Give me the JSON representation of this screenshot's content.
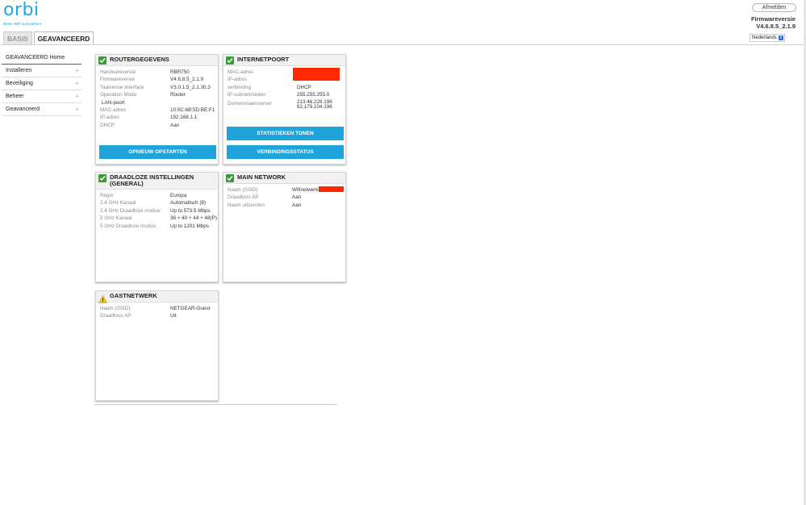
{
  "header": {
    "logo_text": "orbi",
    "tagline": "Better WiFi Everywhere",
    "logout_label": "Afmelden",
    "firmware_label": "Firmwareversie",
    "firmware_value": "V4.6.8.5_2.1.9",
    "language": "Nederlands"
  },
  "tabs": [
    {
      "label": "BASIS",
      "active": false
    },
    {
      "label": "GEAVANCEERD",
      "active": true
    }
  ],
  "sidebar": {
    "items": [
      {
        "label": "GEAVANCEERD Home",
        "expandable": false
      },
      {
        "label": "Installeren",
        "expandable": true
      },
      {
        "label": "Beveiliging",
        "expandable": true
      },
      {
        "label": "Beheer",
        "expandable": true
      },
      {
        "label": "Geavanceerd",
        "expandable": true
      }
    ],
    "plus": "+"
  },
  "router": {
    "title": "ROUTERGEGEVENS",
    "rows": [
      {
        "k": "Hardwareversie",
        "v": "RBR750"
      },
      {
        "k": "Firmwareversie",
        "v": "V4.6.8.5_2.1.9"
      },
      {
        "k": "Taalversie Interface",
        "v": "V3.0.1.5_2.1.30.3"
      },
      {
        "k": "Operation Mode",
        "v": "Router"
      },
      {
        "k": "LAN-poort",
        "v": ""
      },
      {
        "k": "MAC-adres",
        "v": "10:0C:6B:5D:BE:F1"
      },
      {
        "k": "IP-adres",
        "v": "192.168.1.1"
      },
      {
        "k": "DHCP",
        "v": "Aan"
      }
    ],
    "button": "OPNIEUW OPSTARTEN"
  },
  "internet": {
    "title": "INTERNETPOORT",
    "rows": [
      {
        "k": "MAC-adres",
        "v": ""
      },
      {
        "k": "IP-adres",
        "v": ""
      },
      {
        "k": "verbinding",
        "v": "DHCP"
      },
      {
        "k": "IP-subnetmasker",
        "v": "255.255.255.0"
      },
      {
        "k": "Domeinnaamserver",
        "v": "213.46.228.196"
      },
      {
        "k": "",
        "v": "62.179.104.196"
      }
    ],
    "button_stats": "STATISTIEKEN TONEN",
    "button_status": "VERBINDINGSSTATUS",
    "redact_color": "#ff2a00"
  },
  "wireless": {
    "title_line1": "DRAADLOZE INSTELLINGEN",
    "title_line2": "(GENERAL)",
    "rows": [
      {
        "k": "Regio",
        "v": "Europa"
      },
      {
        "k": "2.4 GHz Kanaal",
        "v": "Automatisch (8)"
      },
      {
        "k": "2.4 GHz Draadloze modus:",
        "v": "Up to 573.5 Mbps"
      },
      {
        "k": "5 GHz Kanaal",
        "v": "36 + 40 + 44 + 48(P)"
      },
      {
        "k": "5 GHz Draadloze modus:",
        "v": "Up to 1201 Mbps"
      }
    ]
  },
  "main_network": {
    "title": "MAIN NETWORK",
    "rows": [
      {
        "k": "Naam (SSID)",
        "v": "Wifinetwerk"
      },
      {
        "k": "Draadloos AP",
        "v": "Aan"
      },
      {
        "k": "Naam uitzenden",
        "v": "Aan"
      }
    ]
  },
  "guest": {
    "title": "GASTNETWERK",
    "rows": [
      {
        "k": "Naam (SSID)",
        "v": "NETGEAR-Guest"
      },
      {
        "k": "Draadloos AP",
        "v": "Uit"
      }
    ]
  },
  "colors": {
    "accent": "#1fa3db",
    "check": "#3b9a3b",
    "warning": "#f2c230",
    "active_tab_underline": "#7b3f97"
  }
}
